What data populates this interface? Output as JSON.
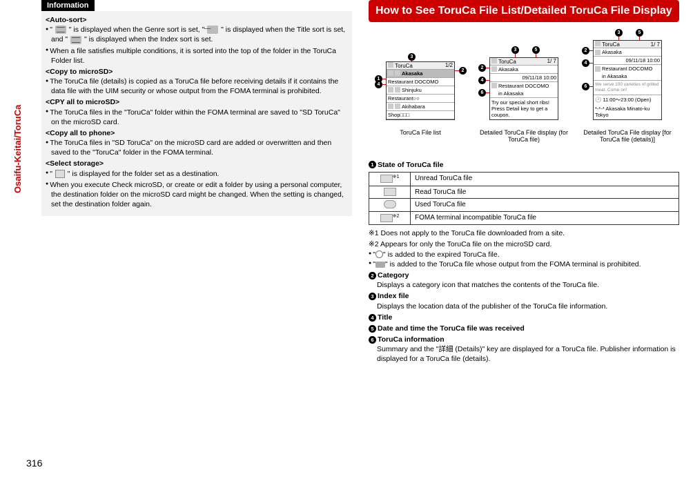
{
  "sidebar": "Osaifu-Keitai/ToruCa",
  "page_number": "316",
  "left": {
    "info_tab": "Information",
    "auto_sort": {
      "head": "<Auto-sort>",
      "p1a": "\"",
      "p1b": "\" is displayed when the Genre sort is set, \"",
      "p1c": "\" is displayed when the Title sort is set, and \"",
      "p1d": "\" is displayed when the Index sort is set.",
      "p2": "When a file satisfies multiple conditions, it is sorted into the top of the folder in the ToruCa Folder list."
    },
    "copy_sd": {
      "head": "<Copy to microSD>",
      "p1": "The ToruCa file (details) is copied as a ToruCa file before receiving details if it contains the data file with the UIM security or whose output from the FOMA terminal is prohibited."
    },
    "cpy_all": {
      "head": "<CPY all to microSD>",
      "p1": "The ToruCa files in the \"ToruCa\" folder within the FOMA terminal are saved to \"SD ToruCa\" on the microSD card."
    },
    "copy_phone": {
      "head": "<Copy all to phone>",
      "p1": "The ToruCa files in \"SD ToruCa\" on the microSD card are added or overwritten and then saved to the \"ToruCa\" folder in the FOMA terminal."
    },
    "select_storage": {
      "head": "<Select storage>",
      "p1a": "\"",
      "p1b": "\" is displayed for the folder set as a destination.",
      "p2": "When you execute Check microSD, or create or edit a folder by using a personal computer, the destination folder on the microSD card might be changed. When the setting is changed, set the destination folder again."
    }
  },
  "right": {
    "header": "How to See ToruCa File List/Detailed ToruCa File Display",
    "list_screen": {
      "title": "ToruCa",
      "count": "1/2",
      "items": [
        "Akasaka",
        "Restaurant DOCOMO",
        "Shinjuku",
        "Restaurant○○",
        "Akihabara",
        "Shop□□□"
      ],
      "caption": "ToruCa File list"
    },
    "detail_screen": {
      "title": "ToruCa",
      "count": "1/ 7",
      "idx": "Akasaka",
      "date": "09/11/18 10:00",
      "line1": "Restaurant DOCOMO",
      "line2": "in Akasaka",
      "msg": "Try our special short ribs! Press Detail key to get a coupon.",
      "caption": "Detailed ToruCa File display (for ToruCa file)"
    },
    "detail2_screen": {
      "title": "ToruCa",
      "count": "1/ 7",
      "idx": "Akasaka",
      "date": "09/11/18 10:00",
      "line1": "Restaurant DOCOMO",
      "line2": "in Akasaka",
      "msg2a": "We serve 100 varieties of grilled meat. Come on!",
      "hours": "11:00〜23:00 (Open)",
      "addr": "*-*-* Akasaka Minato-ku Tokyo",
      "caption": "Detailed ToruCa File display [for ToruCa file (details)]"
    },
    "state": {
      "head": "State of ToruCa file",
      "row1": "Unread ToruCa file",
      "row2": "Read ToruCa file",
      "row3": "Used ToruCa file",
      "row4": "FOMA terminal incompatible ToruCa file",
      "note1": "※1",
      "note2": "※2",
      "ex1": "※1 Does not apply to the ToruCa file downloaded from a site.",
      "ex2": "※2 Appears for only the ToruCa file on the microSD card.",
      "p_a": "\"",
      "p_b": "\" is added to the expired ToruCa file.",
      "p2_a": "\"",
      "p2_b": "\" is added to the ToruCa file whose output from the FOMA terminal is prohibited."
    },
    "cat": {
      "head": "Category",
      "body": "Displays a category icon that matches the contents of the ToruCa file."
    },
    "idx": {
      "head": "Index file",
      "body": "Displays the location data of the publisher of the ToruCa file information."
    },
    "title": {
      "head": "Title"
    },
    "dt": {
      "head": "Date and time the ToruCa file was received"
    },
    "info": {
      "head": "ToruCa information",
      "body": "Summary and the \"詳細 (Details)\" key are displayed for a ToruCa file. Publisher information is displayed for a ToruCa file (details)."
    }
  }
}
